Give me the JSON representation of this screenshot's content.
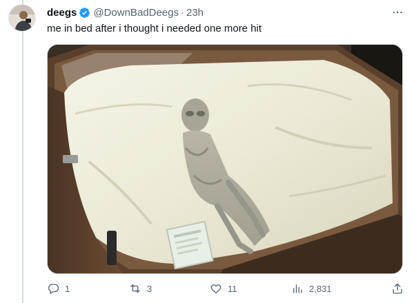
{
  "tweet": {
    "author_name": "deegs",
    "author_handle": "@DownBadDeegs",
    "separator": "·",
    "time": "23h",
    "text": "me in bed after i thought i needed one more hit",
    "verified": true,
    "verified_color": "#1d9bf0"
  },
  "icons": {
    "avatar": "user-avatar",
    "verified": "verified-badge-icon",
    "more": "more-options-icon",
    "reply": "reply-icon",
    "retweet": "retweet-icon",
    "like": "like-icon",
    "views": "views-icon",
    "share": "share-icon"
  },
  "media": {
    "description_icon": "photo-image"
  },
  "metrics": {
    "replies": "1",
    "retweets": "3",
    "likes": "11",
    "views": "2,831"
  },
  "colors": {
    "text": "#0f1419",
    "muted": "#536471",
    "border": "#cfd9de"
  }
}
